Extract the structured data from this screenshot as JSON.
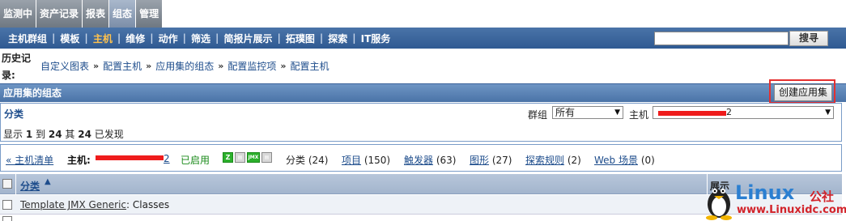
{
  "top_tabs": [
    "监测中",
    "资产记录",
    "报表",
    "组态",
    "管理"
  ],
  "active_top_tab": "组态",
  "sub_nav": [
    "主机群组",
    "模板",
    "主机",
    "维修",
    "动作",
    "筛选",
    "简报片展示",
    "拓璞图",
    "探索",
    "IT服务"
  ],
  "active_sub_nav": "主机",
  "search": {
    "value": "",
    "button_label": "搜寻"
  },
  "history": {
    "label": "历史记录:",
    "crumbs": [
      "自定义图表",
      "配置主机",
      "应用集的组态",
      "配置监控项",
      "配置主机"
    ],
    "separator": "»"
  },
  "section": {
    "title": "应用集的组态",
    "create_button": "创建应用集"
  },
  "filter": {
    "title": "分类",
    "group_label": "群组",
    "group_value": "所有",
    "host_label": "主机",
    "host_value": "2",
    "display_prefix": "显示",
    "display_from": "1",
    "display_to_word": "到",
    "display_to": "24",
    "display_of_word": "其",
    "display_total": "24",
    "display_suffix": "已发现"
  },
  "host_bar": {
    "host_list_link": "« 主机清单",
    "host_label": "主机:",
    "host_value": "2",
    "enabled": "已启用",
    "status_icons": [
      "Z",
      "SNMP",
      "JMX",
      "IPMI"
    ],
    "tabs": [
      {
        "label": "分类",
        "count": "(24)"
      },
      {
        "label": "项目",
        "count": "(150)"
      },
      {
        "label": "触发器",
        "count": "(63)"
      },
      {
        "label": "图形",
        "count": "(27)"
      },
      {
        "label": "探索规则",
        "count": "(2)"
      },
      {
        "label": "Web 场景",
        "count": "(0)"
      }
    ]
  },
  "table": {
    "columns": [
      "分类",
      "展示"
    ],
    "rows": [
      {
        "template": "Template JMX Generic",
        "name": ": Classes"
      }
    ]
  },
  "watermark": {
    "brand": "Linux",
    "cn": "公社",
    "url": "www.Linuxidc.com"
  },
  "colors": {
    "nav_blue": "#2f5a92",
    "active_orange": "#ffc24d",
    "redaction": "#ef1c1c",
    "enabled_green": "#1a8a1a"
  }
}
